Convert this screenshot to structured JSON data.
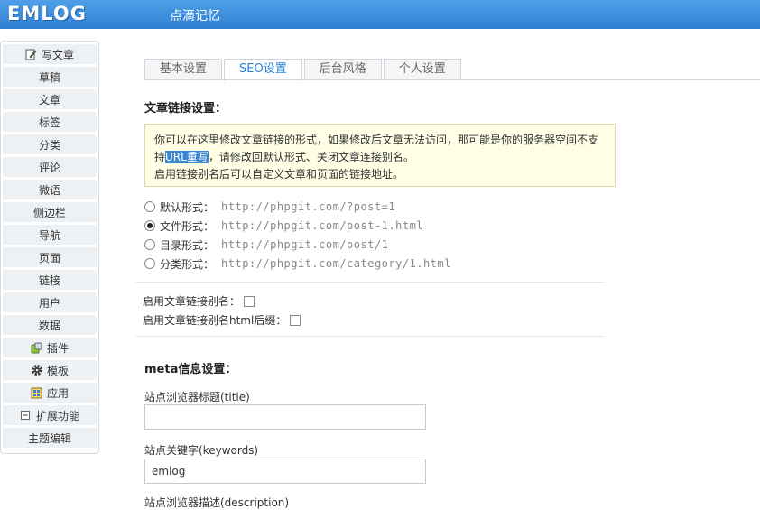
{
  "header": {
    "logo_text": "EMLOG",
    "site_name": "点滴记忆"
  },
  "sidebar": {
    "items": [
      {
        "label": "写文章",
        "icon": "edit-icon"
      },
      {
        "label": "草稿"
      },
      {
        "label": "文章"
      },
      {
        "label": "标签"
      },
      {
        "label": "分类"
      },
      {
        "label": "评论"
      },
      {
        "label": "微语"
      },
      {
        "label": "侧边栏"
      },
      {
        "label": "导航"
      },
      {
        "label": "页面"
      },
      {
        "label": "链接"
      },
      {
        "label": "用户"
      },
      {
        "label": "数据"
      },
      {
        "label": "插件",
        "icon": "plugin-icon"
      },
      {
        "label": "模板",
        "icon": "gear-icon"
      },
      {
        "label": "应用",
        "icon": "app-icon"
      },
      {
        "label": "扩展功能",
        "icon": "collapse-icon"
      },
      {
        "label": "主题编辑"
      }
    ]
  },
  "tabs": [
    {
      "label": "基本设置"
    },
    {
      "label": "SEO设置",
      "active": true
    },
    {
      "label": "后台风格"
    },
    {
      "label": "个人设置"
    }
  ],
  "permalink": {
    "title": "文章链接设置：",
    "notice_line1": "你可以在这里修改文章链接的形式，如果修改后文章无法访问，那可能是你的服务器空间不支",
    "notice_line2_prefix": "持",
    "notice_highlight": "URL重写",
    "notice_line2_suffix": "，请修改回默认形式、关闭文章连接别名。",
    "notice_line3": "启用链接别名后可以自定义文章和页面的链接地址。",
    "options": [
      {
        "label": "默认形式：",
        "url": "http://phpgit.com/?post=1",
        "checked": false
      },
      {
        "label": "文件形式：",
        "url": "http://phpgit.com/post-1.html",
        "checked": true
      },
      {
        "label": "目录形式：",
        "url": "http://phpgit.com/post/1",
        "checked": false
      },
      {
        "label": "分类形式：",
        "url": "http://phpgit.com/category/1.html",
        "checked": false
      }
    ],
    "enable_alias_label": "启用文章链接别名：",
    "enable_alias_html_label": "启用文章链接别名html后缀："
  },
  "meta": {
    "title": "meta信息设置：",
    "site_title_label": "站点浏览器标题(title)",
    "site_title_value": "",
    "keywords_label": "站点关键字(keywords)",
    "keywords_value": "emlog",
    "description_label": "站点浏览器描述(description)"
  }
}
